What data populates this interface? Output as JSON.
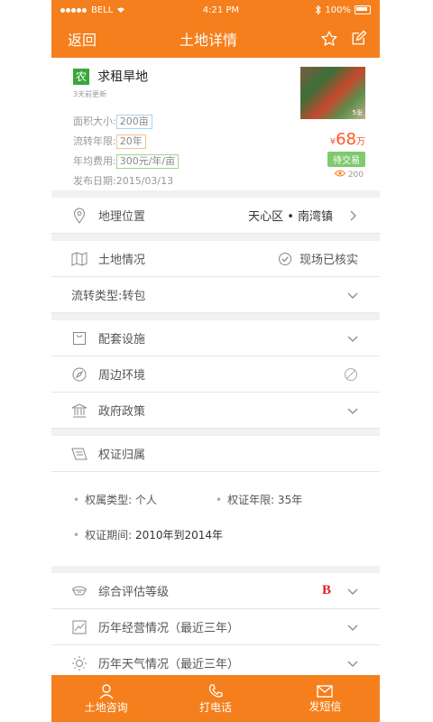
{
  "status_bar": {
    "carrier": "BELL",
    "time": "4:21 PM",
    "battery": "100%"
  },
  "nav": {
    "back_label": "返回",
    "title": "土地详情"
  },
  "listing": {
    "type_tag": "农",
    "title": "求租旱地",
    "updated": "3天前更新",
    "area_label": "面积大小:",
    "area_value": "200亩",
    "term_label": "流转年限:",
    "term_value": "20年",
    "fee_label": "年均费用:",
    "fee_value": "300元/年/亩",
    "date_label": "发布日期:",
    "date_value": "2015/03/13",
    "thumb_caption": "5张",
    "price_currency": "¥",
    "price_value": "68",
    "price_unit": "万",
    "status": "待交易",
    "views": "200"
  },
  "rows": {
    "location_label": "地理位置",
    "location_value": "天心区 • 南湾镇",
    "land_label": "土地情况",
    "land_verified": "现场已核实",
    "transfer_type": "流转类型:转包",
    "facilities": "配套设施",
    "environment": "周边环境",
    "policy": "政府政策",
    "certificate": "权证归属",
    "rating": "综合评估等级",
    "rating_grade": "B",
    "operation": "历年经营情况（最近三年）",
    "weather": "历年天气情况（最近三年）"
  },
  "certificate_detail": {
    "owner_type": "权属类型: 个人",
    "cert_term": "权证年限: 35年",
    "cert_period_label": "权证期间:",
    "cert_period_value": "2010年到2014年"
  },
  "bottom_bar": {
    "consult": "土地咨询",
    "call": "打电话",
    "sms": "发短信"
  },
  "colors": {
    "accent": "#f57f1c",
    "price": "#ff5722",
    "badge_green": "#7fc96f",
    "grade": "#e02020"
  }
}
